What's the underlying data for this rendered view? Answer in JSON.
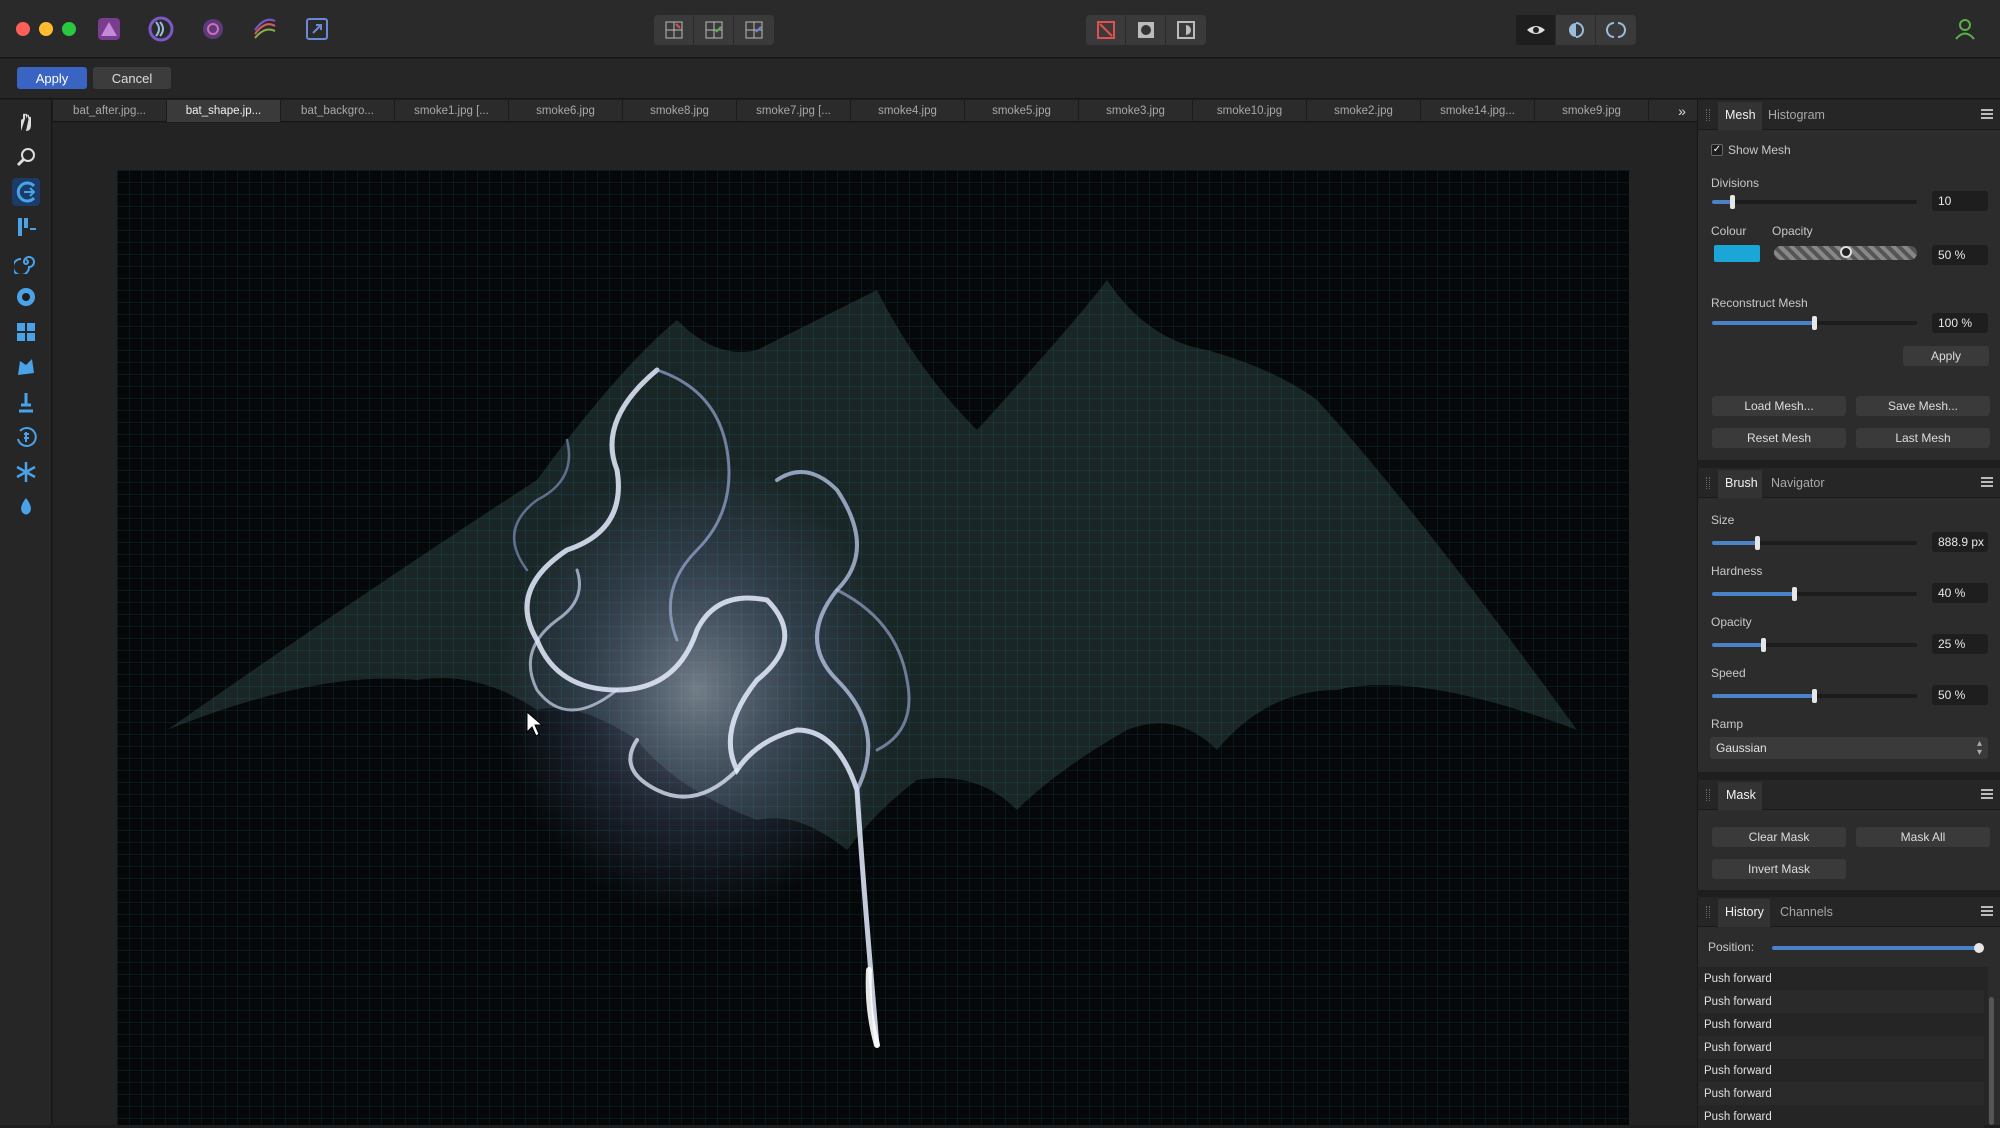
{
  "toolbar": {
    "apply_label": "Apply",
    "cancel_label": "Cancel"
  },
  "tabs": [
    {
      "label": "bat_after.jpg..."
    },
    {
      "label": "bat_shape.jp..."
    },
    {
      "label": "bat_backgro..."
    },
    {
      "label": "smoke1.jpg [..."
    },
    {
      "label": "smoke6.jpg"
    },
    {
      "label": "smoke8.jpg"
    },
    {
      "label": "smoke7.jpg [..."
    },
    {
      "label": "smoke4.jpg"
    },
    {
      "label": "smoke5.jpg"
    },
    {
      "label": "smoke3.jpg"
    },
    {
      "label": "smoke10.jpg"
    },
    {
      "label": "smoke2.jpg"
    },
    {
      "label": "smoke14.jpg..."
    },
    {
      "label": "smoke9.jpg"
    }
  ],
  "tabs_more": "»",
  "mesh_panel": {
    "tab_mesh": "Mesh",
    "tab_histogram": "Histogram",
    "show_mesh_label": "Show Mesh",
    "show_mesh_checked": true,
    "divisions_label": "Divisions",
    "divisions_value": "10",
    "divisions_fraction": 0.1,
    "colour_label": "Colour",
    "colour_swatch": "#1aa7d8",
    "opacity_label": "Opacity",
    "opacity_value": "50 %",
    "opacity_fraction": 0.5,
    "reconstruct_label": "Reconstruct Mesh",
    "reconstruct_value": "100 %",
    "reconstruct_fraction": 0.5,
    "apply_label": "Apply",
    "load_mesh": "Load Mesh...",
    "save_mesh": "Save Mesh...",
    "reset_mesh": "Reset Mesh",
    "last_mesh": "Last Mesh"
  },
  "brush_panel": {
    "tab_brush": "Brush",
    "tab_navigator": "Navigator",
    "size_label": "Size",
    "size_value": "888.9 px",
    "size_fraction": 0.22,
    "hardness_label": "Hardness",
    "hardness_value": "40 %",
    "hardness_fraction": 0.4,
    "opacity_label": "Opacity",
    "opacity_value": "25 %",
    "opacity_fraction": 0.25,
    "speed_label": "Speed",
    "speed_value": "50 %",
    "speed_fraction": 0.5,
    "ramp_label": "Ramp",
    "ramp_value": "Gaussian"
  },
  "mask_panel": {
    "tab_mask": "Mask",
    "clear_mask": "Clear Mask",
    "mask_all": "Mask All",
    "invert_mask": "Invert Mask"
  },
  "history_panel": {
    "tab_history": "History",
    "tab_channels": "Channels",
    "position_label": "Position:",
    "position_fraction": 1.0,
    "items": [
      "Push forward",
      "Push forward",
      "Push forward",
      "Push forward",
      "Push forward",
      "Push forward",
      "Push forward"
    ]
  },
  "colors": {
    "accent": "#3a64c4",
    "mesh": "#1aa7d8"
  }
}
